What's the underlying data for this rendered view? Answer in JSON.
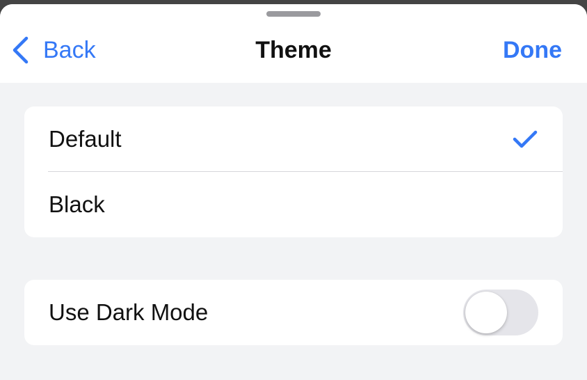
{
  "nav": {
    "back_label": "Back",
    "title": "Theme",
    "done_label": "Done"
  },
  "theme_options": [
    {
      "label": "Default",
      "selected": true
    },
    {
      "label": "Black",
      "selected": false
    }
  ],
  "dark_mode": {
    "label": "Use Dark Mode",
    "enabled": false
  },
  "icons": {
    "back": "chevron-left-icon",
    "selected": "checkmark-icon"
  },
  "colors": {
    "accent": "#3478f6",
    "background": "#f2f3f5",
    "card": "#ffffff",
    "toggle_off": "#e5e5ea"
  }
}
